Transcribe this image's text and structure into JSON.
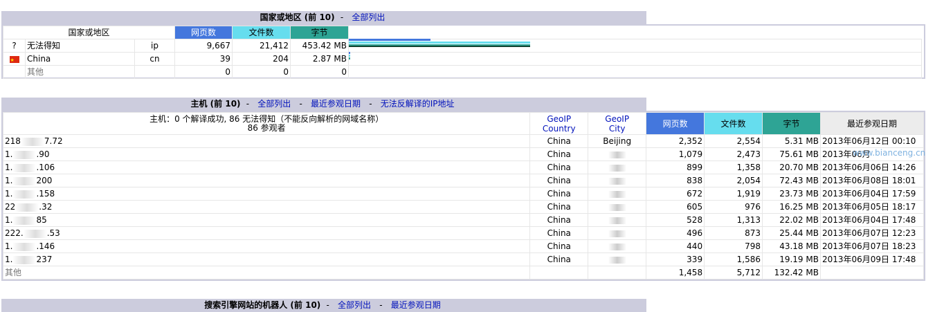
{
  "countries": {
    "title": "国家或地区 (前 10)",
    "sep": "-",
    "link_all": "全部列出",
    "col_country": "国家或地区",
    "col_pages": "网页数",
    "col_files": "文件数",
    "col_bytes": "字节",
    "rows": [
      {
        "icon": "?",
        "name": "无法得知",
        "code": "ip",
        "pages": "9,667",
        "files": "21,412",
        "bytes": "453.42 MB"
      },
      {
        "icon": "flag",
        "name": "China",
        "code": "cn",
        "pages": "39",
        "files": "204",
        "bytes": "2.87 MB"
      },
      {
        "icon": "",
        "name": "其他",
        "code": "",
        "pages": "0",
        "files": "0",
        "bytes": "0"
      }
    ]
  },
  "hosts": {
    "title": "主机 (前 10)",
    "sep": "-",
    "link_all": "全部列出",
    "link_lastvisit": "最近参观日期",
    "link_unresolved": "无法反解译的IP地址",
    "summary_line1": "主机：0 个解译成功, 86 无法得知（不能反向解析的网域名称）",
    "summary_line2": "86 参观者",
    "col_geoip_country_1": "GeoIP",
    "col_geoip_country_2": "Country",
    "col_geoip_city_1": "GeoIP",
    "col_geoip_city_2": "City",
    "col_pages": "网页数",
    "col_files": "文件数",
    "col_bytes": "字节",
    "col_lastvisit": "最近参观日期",
    "rows": [
      {
        "ip_a": "218",
        "ip_b": "7.72",
        "country": "China",
        "city": "Beijing",
        "pages": "2,352",
        "files": "2,554",
        "bytes": "5.31 MB",
        "last": "2013年06月12日 00:10"
      },
      {
        "ip_a": "1.",
        "ip_b": ".90",
        "country": "China",
        "city": "",
        "pages": "1,079",
        "files": "2,473",
        "bytes": "75.61 MB",
        "last": "2013年06月"
      },
      {
        "ip_a": "1.",
        "ip_b": ".106",
        "country": "China",
        "city": "",
        "pages": "899",
        "files": "1,358",
        "bytes": "20.70 MB",
        "last": "2013年06月06日 14:26"
      },
      {
        "ip_a": "1.",
        "ip_b": "200",
        "country": "China",
        "city": "",
        "pages": "838",
        "files": "2,054",
        "bytes": "72.43 MB",
        "last": "2013年06月08日 18:01"
      },
      {
        "ip_a": "1.",
        "ip_b": ".158",
        "country": "China",
        "city": "",
        "pages": "672",
        "files": "1,919",
        "bytes": "23.73 MB",
        "last": "2013年06月04日 17:59"
      },
      {
        "ip_a": "22",
        "ip_b": ".32",
        "country": "China",
        "city": "",
        "pages": "605",
        "files": "976",
        "bytes": "16.25 MB",
        "last": "2013年06月05日 18:17"
      },
      {
        "ip_a": "1.",
        "ip_b": "85",
        "country": "China",
        "city": "",
        "pages": "528",
        "files": "1,313",
        "bytes": "22.02 MB",
        "last": "2013年06月04日 17:48"
      },
      {
        "ip_a": "222.",
        "ip_b": ".53",
        "country": "China",
        "city": "",
        "pages": "496",
        "files": "873",
        "bytes": "25.44 MB",
        "last": "2013年06月07日 12:23"
      },
      {
        "ip_a": "1.",
        "ip_b": ".146",
        "country": "China",
        "city": "",
        "pages": "440",
        "files": "798",
        "bytes": "43.18 MB",
        "last": "2013年06月07日 18:23"
      },
      {
        "ip_a": "1.",
        "ip_b": "237",
        "country": "China",
        "city": "",
        "pages": "339",
        "files": "1,586",
        "bytes": "19.19 MB",
        "last": "2013年06月09日 17:48"
      }
    ],
    "other": {
      "label": "其他",
      "pages": "1,458",
      "files": "5,712",
      "bytes": "132.42 MB"
    }
  },
  "robots": {
    "title": "搜索引擎网站的机器人 (前 10)",
    "sep": "-",
    "link_all": "全部列出",
    "link_lastvisit": "最近参观日期"
  },
  "watermark": "www.bianceng.cn",
  "colors": {
    "header_bg": "#ccccdd",
    "pages": "#4477dd",
    "files": "#66ddee",
    "bytes": "#2ea495",
    "link": "#0011bb"
  }
}
